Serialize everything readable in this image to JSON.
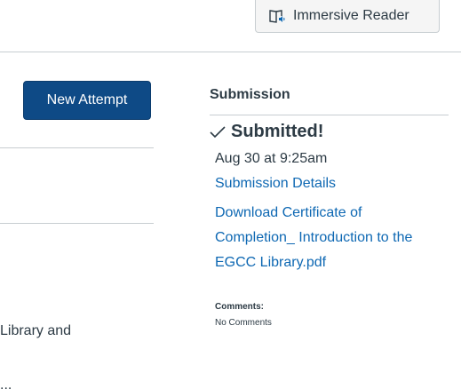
{
  "header": {
    "immersive_reader_label": "Immersive Reader",
    "immersive_reader_icon": "immersive-reader-icon"
  },
  "left": {
    "new_attempt_label": "New Attempt",
    "body_text_1": "Library and",
    "body_text_2": "... "
  },
  "submission": {
    "heading": "Submission",
    "status_icon": "check-icon",
    "status": "Submitted!",
    "date": "Aug 30 at 9:25am",
    "details_link": "Submission Details",
    "download_link": "Download Certificate of Completion_ Introduction to the EGCC Library.pdf",
    "comments_label": "Comments:",
    "comments_value": "No Comments"
  },
  "colors": {
    "primary_button": "#0e4a86",
    "link": "#0e68b3",
    "text": "#2d3b45",
    "divider": "#c7cdd1"
  }
}
